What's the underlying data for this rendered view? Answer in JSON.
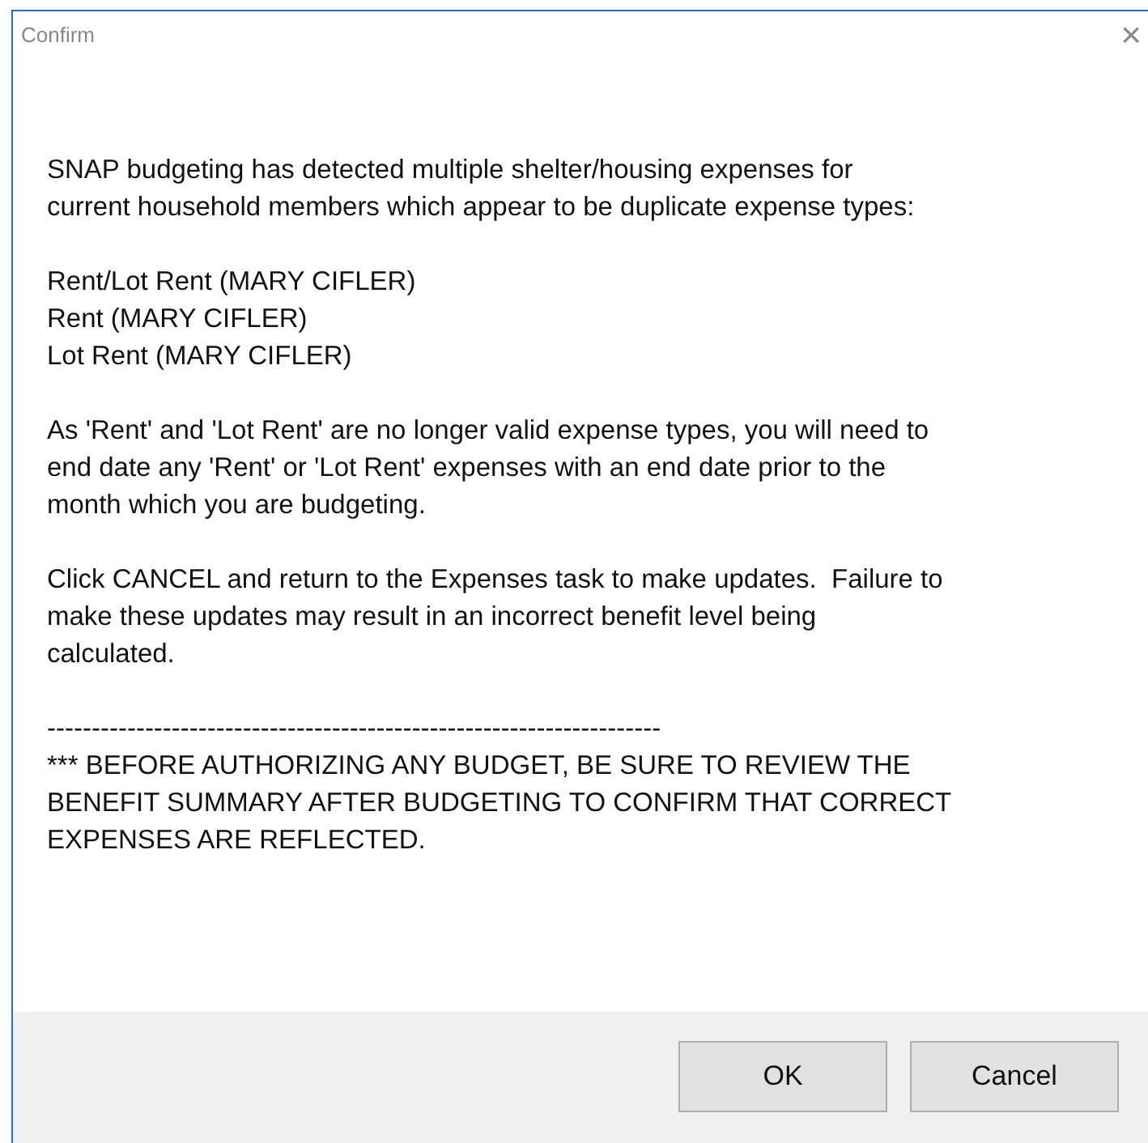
{
  "window": {
    "title": "Confirm",
    "close": "×"
  },
  "paragraphs": [
    {
      "lines": [
        "SNAP budgeting has detected multiple shelter/housing expenses for",
        "current household members which appear to be duplicate expense types:"
      ]
    },
    {
      "lines": [
        "Rent/Lot Rent (MARY CIFLER)",
        "Rent (MARY CIFLER)",
        "Lot Rent (MARY CIFLER)"
      ]
    },
    {
      "lines": [
        "As 'Rent' and 'Lot Rent' are no longer valid expense types, you will need to",
        "end date any 'Rent' or 'Lot Rent' expenses with an end date prior to the",
        "month which you are budgeting."
      ]
    },
    {
      "lines": [
        "Click CANCEL and return to the Expenses task to make updates.  Failure to",
        "make these updates may result in an incorrect benefit level being",
        "calculated."
      ]
    },
    {
      "lines": [
        "---------------------------------------------------------------------",
        "*** BEFORE AUTHORIZING ANY BUDGET, BE SURE TO REVIEW THE",
        "BENEFIT SUMMARY AFTER BUDGETING TO CONFIRM THAT CORRECT",
        "EXPENSES ARE REFLECTED."
      ]
    }
  ],
  "buttons": [
    "OK",
    "Cancel"
  ]
}
